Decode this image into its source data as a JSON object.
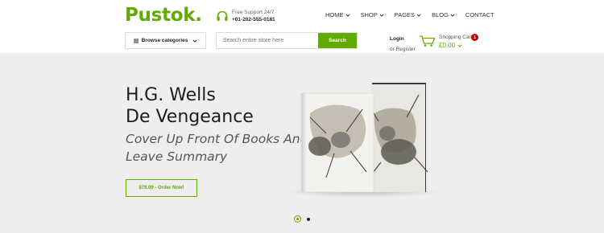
{
  "brand": {
    "logo": "Pustok.",
    "accent": "#62ab00"
  },
  "support": {
    "label": "Free Support 24/7",
    "phone": "+01-202-555-0181",
    "icon": "headset-icon"
  },
  "nav": {
    "items": [
      {
        "label": "HOME",
        "has_dropdown": true
      },
      {
        "label": "SHOP",
        "has_dropdown": true
      },
      {
        "label": "PAGES",
        "has_dropdown": true
      },
      {
        "label": "BLOG",
        "has_dropdown": true
      },
      {
        "label": "CONTACT",
        "has_dropdown": false
      }
    ]
  },
  "browse": {
    "label": "Browse categories",
    "icon": "menu-bars-icon"
  },
  "search": {
    "placeholder": "Search entire store here",
    "value": "",
    "button_label": "Search"
  },
  "account": {
    "login_label": "Login",
    "register_label": "or Register"
  },
  "cart": {
    "label": "Shopping Cart",
    "total": "£0.00",
    "count": "1",
    "icon": "cart-icon",
    "badge_color": "#c40000"
  },
  "hero": {
    "title_line1": "H.G. Wells",
    "title_line2": "De Vengeance",
    "subtitle_line1": "Cover Up Front Of Books And",
    "subtitle_line2": "Leave Summary",
    "button_label": "$78.09 - Order Now!",
    "background": "#eeeeee"
  },
  "slider": {
    "active_index": 1,
    "total": 2
  }
}
